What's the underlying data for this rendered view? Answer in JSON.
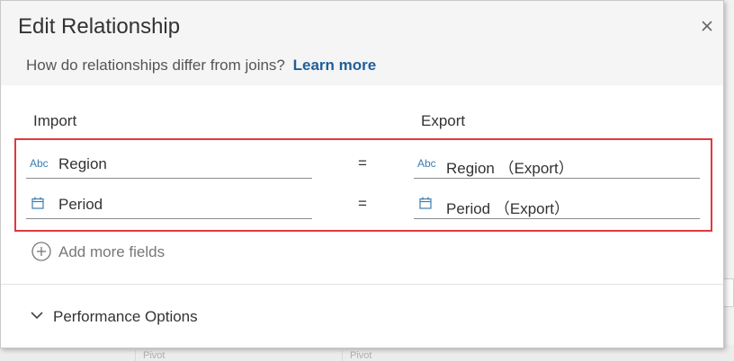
{
  "dialog": {
    "title": "Edit Relationship",
    "subtitle": "How do relationships differ from joins?",
    "learn_more": "Learn more"
  },
  "columns": {
    "left": "Import",
    "right": "Export"
  },
  "rows": [
    {
      "left_type": "Abc",
      "left_icon": "text-type-icon",
      "left": "Region",
      "operator": "=",
      "right_type": "Abc",
      "right_icon": "text-type-icon",
      "right": "Region （Export）"
    },
    {
      "left_type": "calendar",
      "left_icon": "calendar-icon",
      "left": "Period",
      "operator": "=",
      "right_type": "calendar",
      "right_icon": "calendar-icon",
      "right": "Period （Export）"
    }
  ],
  "add_more_fields": "Add more fields",
  "performance_options": "Performance Options",
  "background": {
    "cells": [
      "Pivot",
      "Pivot"
    ]
  },
  "colors": {
    "accent": "#1f5f99",
    "highlight_border": "#e0393e",
    "icon": "#3c7db0"
  }
}
